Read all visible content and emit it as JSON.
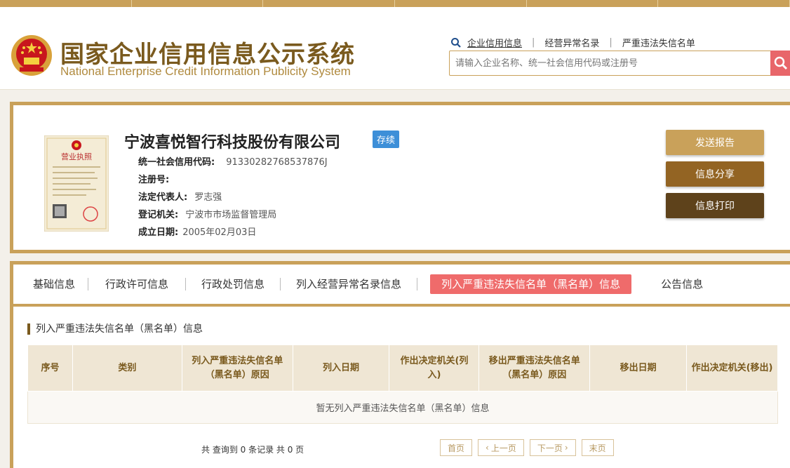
{
  "site": {
    "title": "国家企业信用信息公示系统",
    "title_en": "National Enterprise Credit Information Publicity System"
  },
  "search": {
    "links": [
      "企业信用信息",
      "经营异常名录",
      "严重违法失信名单"
    ],
    "placeholder": "请输入企业名称、统一社会信用代码或注册号"
  },
  "company": {
    "name": "宁波喜悦智行科技股份有限公司",
    "status": "存续",
    "fields": [
      {
        "label": "统一社会信用代码:",
        "value": "91330282768537876J"
      },
      {
        "label": "注册号:",
        "value": ""
      },
      {
        "label": "法定代表人:",
        "value": "罗志强"
      },
      {
        "label": "登记机关:",
        "value": "宁波市市场监督管理局"
      },
      {
        "label": "成立日期:",
        "value": "2005年02月03日"
      }
    ],
    "license_title": "营业执照"
  },
  "actions": {
    "send_report": "发送报告",
    "share": "信息分享",
    "print": "信息打印"
  },
  "tabs": [
    "基础信息",
    "行政许可信息",
    "行政处罚信息",
    "列入经营异常名录信息",
    "列入严重违法失信名单（黑名单）信息",
    "公告信息"
  ],
  "active_tab": 4,
  "section": {
    "title": "列入严重违法失信名单（黑名单）信息",
    "columns": [
      "序号",
      "类别",
      "列入严重违法失信名单（黑名单）原因",
      "列入日期",
      "作出决定机关(列入)",
      "移出严重违法失信名单（黑名单）原因",
      "移出日期",
      "作出决定机关(移出)"
    ],
    "empty_text": "暂无列入严重违法失信名单（黑名单）信息"
  },
  "pagination": {
    "summary": "共 查询到 0 条记录 共 0 页",
    "first": "首页",
    "prev": "上一页",
    "next": "下一页",
    "last": "末页"
  },
  "colors": {
    "gold": "#c9a15a",
    "brown": "#7a5a1e",
    "active_tab": "#ef6b6b",
    "status_blue": "#3d8fd8",
    "btn_send": "#c9a15a",
    "btn_share": "#936423",
    "btn_print": "#5e421b"
  }
}
